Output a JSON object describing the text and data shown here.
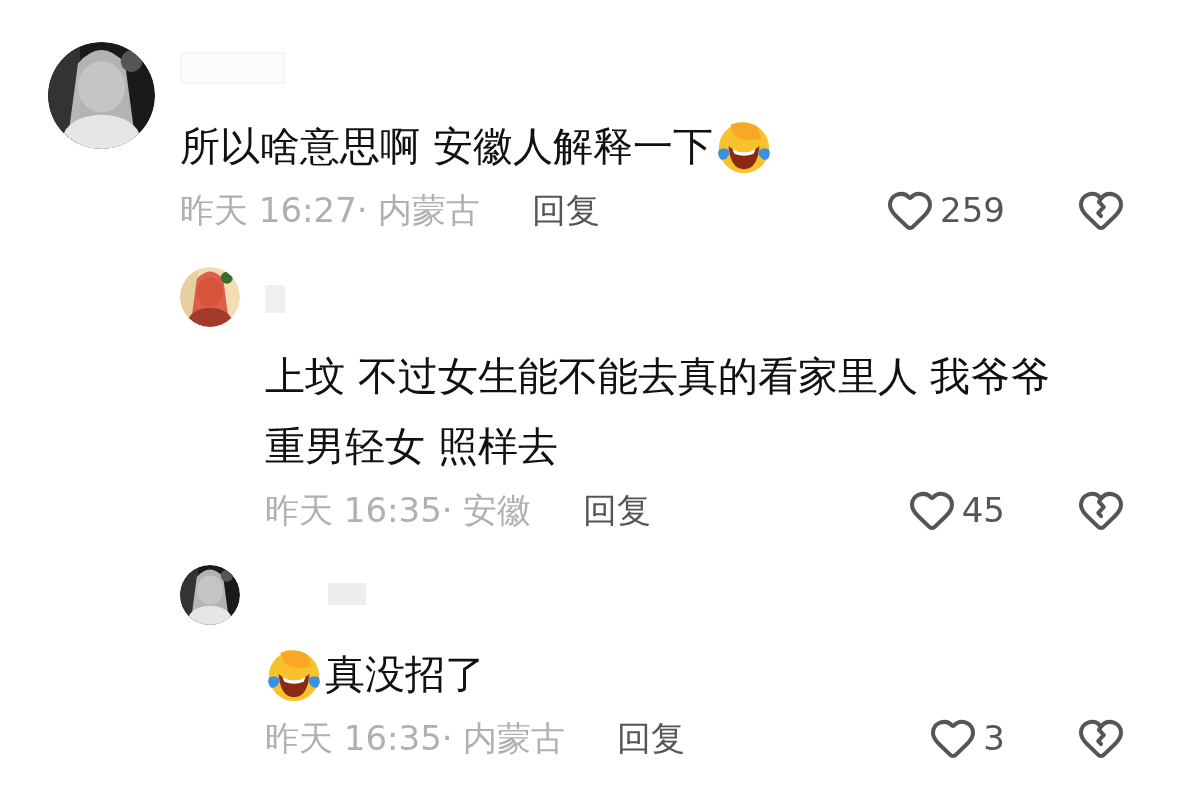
{
  "comments": [
    {
      "text": "所以啥意思啊 安徽人解释一下",
      "emoji_before": false,
      "emoji_after": true,
      "meta": "昨天 16:27· 内蒙古",
      "reply_label": "回复",
      "likes": "259",
      "replies": [
        {
          "text": "上坟 不过女生能不能去真的看家里人 我爷爷重男轻女 照样去",
          "emoji_before": false,
          "emoji_after": false,
          "meta": "昨天 16:35· 安徽",
          "reply_label": "回复",
          "likes": "45"
        },
        {
          "text": "真没招了",
          "emoji_before": true,
          "emoji_after": false,
          "meta": "昨天 16:35· 内蒙古",
          "reply_label": "回复",
          "likes": "3"
        }
      ]
    }
  ]
}
